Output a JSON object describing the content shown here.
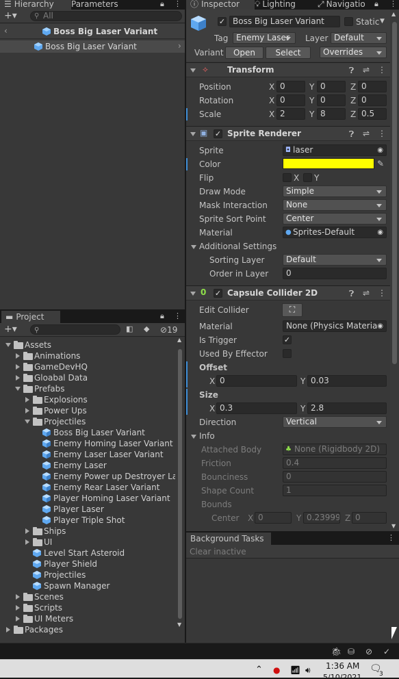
{
  "hierarchy": {
    "tabs": [
      "Hierarchy",
      "Parameters"
    ],
    "search_placeholder": "All",
    "breadcrumb": "Boss Big Laser Variant",
    "items": [
      {
        "label": "Boss Big Laser Variant"
      }
    ]
  },
  "inspector": {
    "tabs": [
      "Inspector",
      "Lighting",
      "Navigatio"
    ],
    "object_name": "Boss Big Laser Variant",
    "static_label": "Static",
    "tag_label": "Tag",
    "tag_value": "Enemy Laser",
    "layer_label": "Layer",
    "layer_value": "Default",
    "variant_label": "Variant",
    "open_label": "Open",
    "select_label": "Select",
    "overrides_label": "Overrides",
    "transform": {
      "title": "Transform",
      "position_label": "Position",
      "rotation_label": "Rotation",
      "scale_label": "Scale",
      "x": "X",
      "y": "Y",
      "z": "Z",
      "position": [
        "0",
        "0",
        "0"
      ],
      "rotation": [
        "0",
        "0",
        "0"
      ],
      "scale": [
        "2",
        "8",
        "0.5"
      ]
    },
    "sprite_renderer": {
      "title": "Sprite Renderer",
      "sprite_label": "Sprite",
      "sprite_value": "laser",
      "color_label": "Color",
      "color_value": "#ffff00",
      "flip_label": "Flip",
      "flip_x": "X",
      "flip_y": "Y",
      "draw_mode_label": "Draw Mode",
      "draw_mode_value": "Simple",
      "mask_label": "Mask Interaction",
      "mask_value": "None",
      "sort_point_label": "Sprite Sort Point",
      "sort_point_value": "Center",
      "material_label": "Material",
      "material_value": "Sprites-Default",
      "additional_label": "Additional Settings",
      "sorting_layer_label": "Sorting Layer",
      "sorting_layer_value": "Default",
      "order_label": "Order in Layer",
      "order_value": "0"
    },
    "capsule": {
      "title": "Capsule Collider 2D",
      "edit_label": "Edit Collider",
      "material_label": "Material",
      "material_value": "None (Physics Material",
      "trigger_label": "Is Trigger",
      "effector_label": "Used By Effector",
      "offset_label": "Offset",
      "offset_x": "0",
      "offset_y": "0.03",
      "size_label": "Size",
      "size_x": "0.3",
      "size_y": "2.8",
      "direction_label": "Direction",
      "direction_value": "Vertical",
      "info_label": "Info",
      "attached_label": "Attached Body",
      "attached_value": "None (Rigidbody 2D)",
      "friction_label": "Friction",
      "friction_value": "0.4",
      "bounciness_label": "Bounciness",
      "bounciness_value": "0",
      "shape_label": "Shape Count",
      "shape_value": "1",
      "bounds_label": "Bounds",
      "center_label": "Center",
      "center_x": "0",
      "center_y": "0.23999",
      "center_z": "0"
    }
  },
  "project": {
    "tab": "Project",
    "hidden_count": "19",
    "tree": [
      {
        "label": "Assets",
        "indent": 0,
        "type": "folder",
        "arrow": "down"
      },
      {
        "label": "Animations",
        "indent": 1,
        "type": "folder",
        "arrow": "right"
      },
      {
        "label": "GameDevHQ",
        "indent": 1,
        "type": "folder",
        "arrow": "right"
      },
      {
        "label": "Gloabal Data",
        "indent": 1,
        "type": "folder",
        "arrow": "right"
      },
      {
        "label": "Prefabs",
        "indent": 1,
        "type": "folder",
        "arrow": "down"
      },
      {
        "label": "Explosions",
        "indent": 2,
        "type": "folder",
        "arrow": "right"
      },
      {
        "label": "Power Ups",
        "indent": 2,
        "type": "folder",
        "arrow": "right"
      },
      {
        "label": "Projectiles",
        "indent": 2,
        "type": "folder",
        "arrow": "down"
      },
      {
        "label": "Boss Big Laser Variant",
        "indent": 3,
        "type": "variant",
        "arrow": ""
      },
      {
        "label": "Enemy Homing Laser Variant",
        "indent": 3,
        "type": "variant",
        "arrow": ""
      },
      {
        "label": "Enemy Laser Laser Variant",
        "indent": 3,
        "type": "variant",
        "arrow": ""
      },
      {
        "label": "Enemy Laser",
        "indent": 3,
        "type": "prefab",
        "arrow": ""
      },
      {
        "label": "Enemy Power up Destroyer Lase",
        "indent": 3,
        "type": "variant",
        "arrow": ""
      },
      {
        "label": "Enemy Rear Laser Variant",
        "indent": 3,
        "type": "variant",
        "arrow": ""
      },
      {
        "label": "Player Homing Laser Variant",
        "indent": 3,
        "type": "variant",
        "arrow": ""
      },
      {
        "label": "Player Laser",
        "indent": 3,
        "type": "prefab",
        "arrow": ""
      },
      {
        "label": "Player Triple Shot",
        "indent": 3,
        "type": "prefab",
        "arrow": ""
      },
      {
        "label": "Ships",
        "indent": 2,
        "type": "folder",
        "arrow": "right"
      },
      {
        "label": "UI",
        "indent": 2,
        "type": "folder",
        "arrow": "right"
      },
      {
        "label": "Level Start Asteroid",
        "indent": 2,
        "type": "prefab",
        "arrow": ""
      },
      {
        "label": "Player Shield",
        "indent": 2,
        "type": "prefab",
        "arrow": ""
      },
      {
        "label": "Projectiles",
        "indent": 2,
        "type": "prefab",
        "arrow": ""
      },
      {
        "label": "Spawn Manager",
        "indent": 2,
        "type": "prefab",
        "arrow": ""
      },
      {
        "label": "Scenes",
        "indent": 1,
        "type": "folder",
        "arrow": "right"
      },
      {
        "label": "Scripts",
        "indent": 1,
        "type": "folder",
        "arrow": "right"
      },
      {
        "label": "UI Meters",
        "indent": 1,
        "type": "folder",
        "arrow": "right"
      },
      {
        "label": "Packages",
        "indent": 0,
        "type": "folder",
        "arrow": "right"
      }
    ]
  },
  "background_tasks": {
    "tab": "Background Tasks",
    "clear_label": "Clear inactive"
  },
  "taskbar": {
    "time": "1:36 AM",
    "date": "5/10/2021",
    "notification_count": "3"
  }
}
